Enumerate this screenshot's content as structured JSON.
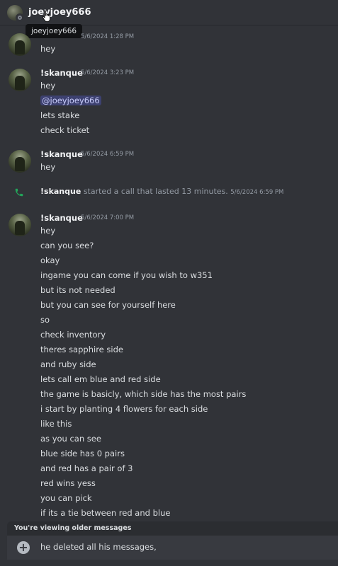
{
  "header": {
    "username": "joeyjoey666"
  },
  "tooltip": {
    "text": "joeyjoey666"
  },
  "messages": [
    {
      "author": "",
      "timestamp": "5/6/2024 1:28 PM",
      "lines": [
        "hey"
      ]
    },
    {
      "author": "!skanque",
      "timestamp": "5/6/2024 3:23 PM",
      "lines": [
        "hey",
        "@joeyjoey666",
        "lets stake",
        "check ticket"
      ]
    },
    {
      "author": "!skanque",
      "timestamp": "5/6/2024 6:59 PM",
      "lines": [
        "hey"
      ]
    },
    {
      "author": "!skanque",
      "timestamp": "5/6/2024 7:00 PM",
      "lines": [
        "hey",
        "can you see?",
        "okay",
        "ingame you can come if you wish to w351",
        "but its not needed",
        "but you can see for yourself here",
        "so",
        "check inventory",
        "theres sapphire side",
        "and ruby side",
        "lets call em blue and red side",
        "the game is basicly, which side has the most pairs",
        "i start by planting 4 flowers for each side",
        "like this",
        "as you can see",
        "blue side has 0 pairs",
        "and red has a pair of 3",
        "red wins yess",
        "you can pick",
        "if its a tie between red and blue"
      ]
    }
  ],
  "system_call": {
    "author": "!skanque",
    "text": "started a call that lasted 13 minutes.",
    "timestamp": "5/6/2024 6:59 PM"
  },
  "banner": {
    "text": "You're viewing older messages"
  },
  "composer": {
    "value": "he deleted all his messages,"
  },
  "colors": {
    "accent": "#5865f2",
    "background": "#313338",
    "call_icon": "#23a55a"
  },
  "icons": {
    "call": "phone-icon",
    "attach": "plus-circle-icon",
    "status": "offline-status-icon"
  }
}
